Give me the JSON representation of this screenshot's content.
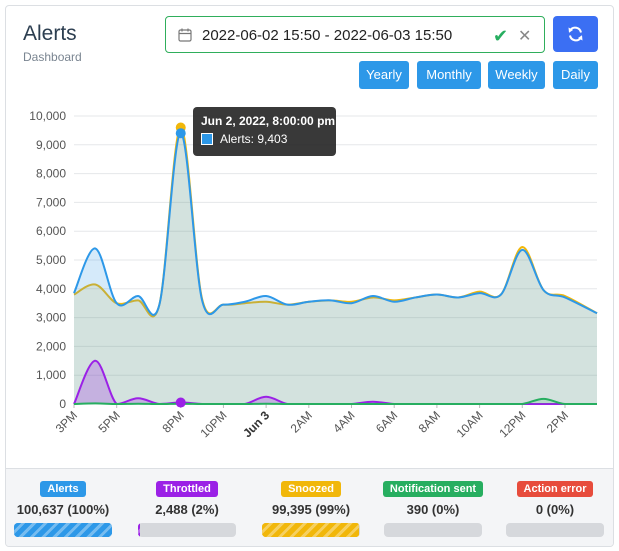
{
  "header": {
    "title": "Alerts",
    "subtitle": "Dashboard"
  },
  "daterange": {
    "value": "2022-06-02 15:50 - 2022-06-03 15:50",
    "icon": "calendar-icon",
    "confirm_icon": "check-icon",
    "clear_icon": "close-icon"
  },
  "refresh": {
    "icon": "refresh-icon",
    "color": "#3b6ff3"
  },
  "periods": [
    "Yearly",
    "Monthly",
    "Weekly",
    "Daily"
  ],
  "chart_data": {
    "type": "area",
    "x_labels": [
      "3PM",
      "5PM",
      "8PM",
      "10PM",
      "Jun 3",
      "2AM",
      "4AM",
      "6AM",
      "8AM",
      "10AM",
      "12PM",
      "2PM"
    ],
    "x_label_positions_hours": [
      0,
      2,
      5,
      7,
      9,
      11,
      13,
      15,
      17,
      19,
      21,
      23
    ],
    "y_ticks": [
      "0",
      "1,000",
      "2,000",
      "3,000",
      "4,000",
      "5,000",
      "6,000",
      "7,000",
      "8,000",
      "9,000",
      "10,000"
    ],
    "ylim": [
      0,
      10000
    ],
    "xlim_hours": [
      0,
      24.5
    ],
    "series": [
      {
        "name": "Snoozed",
        "color": "#f1b70a",
        "x": [
          0,
          1,
          2,
          3,
          4,
          5,
          6,
          7,
          8,
          9,
          10,
          11,
          12,
          13,
          14,
          15,
          16,
          17,
          18,
          19,
          20,
          21,
          22,
          23,
          24.5
        ],
        "y": [
          3800,
          4150,
          3500,
          3600,
          3450,
          9600,
          3650,
          3450,
          3500,
          3550,
          3450,
          3550,
          3600,
          3550,
          3700,
          3600,
          3700,
          3800,
          3700,
          3900,
          3800,
          5450,
          3950,
          3750,
          3150
        ]
      },
      {
        "name": "Alerts",
        "color": "#2d98e8",
        "x": [
          0,
          1,
          2,
          3,
          4,
          5,
          6,
          7,
          8,
          9,
          10,
          11,
          12,
          13,
          14,
          15,
          16,
          17,
          18,
          19,
          20,
          21,
          22,
          23,
          24.5
        ],
        "y": [
          3850,
          5400,
          3500,
          3750,
          3450,
          9403,
          3600,
          3450,
          3550,
          3750,
          3450,
          3550,
          3600,
          3500,
          3750,
          3550,
          3700,
          3800,
          3700,
          3850,
          3800,
          5350,
          3950,
          3700,
          3150
        ]
      },
      {
        "name": "Throttled",
        "color": "#9b21e6",
        "x": [
          0,
          1,
          2,
          3,
          4,
          5,
          6,
          7,
          8,
          9,
          10,
          11,
          12,
          13,
          14,
          15,
          16,
          17,
          18,
          19,
          20,
          21,
          22,
          23,
          24.5
        ],
        "y": [
          0,
          1500,
          0,
          200,
          0,
          50,
          0,
          0,
          0,
          250,
          0,
          0,
          0,
          0,
          80,
          0,
          0,
          0,
          0,
          0,
          0,
          0,
          0,
          0,
          0
        ]
      },
      {
        "name": "Notification sent",
        "color": "#27ae60",
        "x": [
          0,
          1,
          2,
          3,
          4,
          5,
          6,
          7,
          8,
          9,
          10,
          11,
          12,
          13,
          14,
          15,
          16,
          17,
          18,
          19,
          20,
          21,
          22,
          23,
          24.5
        ],
        "y": [
          0,
          20,
          0,
          10,
          0,
          10,
          0,
          0,
          0,
          10,
          0,
          0,
          0,
          0,
          0,
          0,
          0,
          0,
          0,
          0,
          0,
          0,
          180,
          0,
          0
        ]
      }
    ],
    "tooltip": {
      "title": "Jun 2, 2022, 8:00:00 pm",
      "series": "Alerts",
      "value": "Alerts: 9,403"
    }
  },
  "stats": [
    {
      "label": "Alerts",
      "value": "100,637 (100%)",
      "color": "#2d98e8",
      "fill": 1.0
    },
    {
      "label": "Throttled",
      "value": "2,488 (2%)",
      "color": "#9b21e6",
      "fill": 0.02
    },
    {
      "label": "Snoozed",
      "value": "99,395 (99%)",
      "color": "#f1b70a",
      "fill": 0.99
    },
    {
      "label": "Notification sent",
      "value": "390 (0%)",
      "color": "#27ae60",
      "fill": 0
    },
    {
      "label": "Action error",
      "value": "0 (0%)",
      "color": "#e74c3c",
      "fill": 0
    }
  ]
}
